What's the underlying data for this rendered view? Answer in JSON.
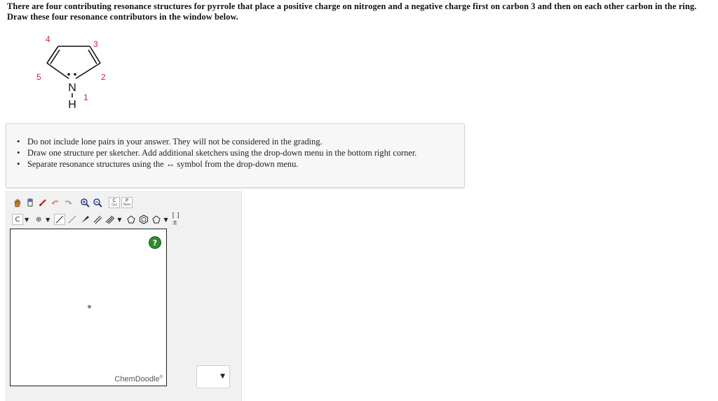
{
  "question": {
    "text": "There are four contributing resonance structures for pyrrole that place a positive charge on nitrogen and a negative charge first on carbon 3 and then on each other carbon in the ring. Draw these four resonance contributors in the window below."
  },
  "molecule": {
    "atom_label": "N",
    "hydrogen_label": "H",
    "numbers": [
      "1",
      "2",
      "3",
      "4",
      "5"
    ],
    "number_color": "#d0202f"
  },
  "instructions": {
    "items": [
      "Do not include lone pairs in your answer. They will not be considered in the grading.",
      "Draw one structure per sketcher. Add additional sketchers using the drop-down menu in the bottom right corner.",
      "Separate resonance structures using the ↔ symbol from the drop-down menu."
    ]
  },
  "toolbar": {
    "row1": [
      "hand-icon",
      "eraser-icon",
      "pencil-icon",
      "undo-icon",
      "redo-icon",
      "zoom-in-icon",
      "zoom-out-icon",
      "copy-icon",
      "paste-icon"
    ],
    "copy_label": "Cpy",
    "paste_label": "Paste",
    "atom_label": "C",
    "charge_label": "⊕",
    "row2": [
      "atom-select",
      "charge-select",
      "single-bond-icon",
      "dashed-bond-icon",
      "wedge-bond-icon",
      "double-bond-icon",
      "triple-bond-icon",
      "cyclopentane-icon",
      "benzene-icon",
      "ring-icon",
      "bracket-icon"
    ],
    "bracket_label": "[ ]±"
  },
  "canvas": {
    "help_label": "?",
    "brand": "ChemDoodle",
    "brand_mark": "®"
  },
  "sketcher_select": {
    "value": ""
  },
  "colors": {
    "help_green": "#2f8a2f",
    "number_red": "#d0202f"
  }
}
